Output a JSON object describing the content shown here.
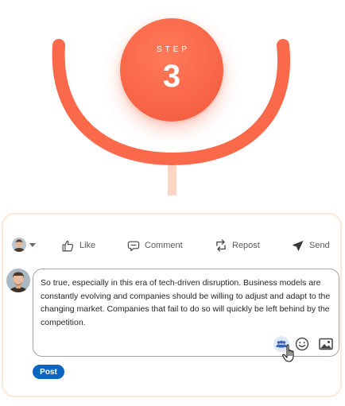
{
  "step": {
    "label": "STEP",
    "number": "3"
  },
  "colors": {
    "accent": "#f86849",
    "arc": "#f9694a",
    "connector": "#fcd5c4",
    "card_border": "#fde7d7",
    "post_button": "#0a66c2",
    "mention_icon": "#3564b3"
  },
  "action_bar": {
    "avatar_icon": "user-avatar",
    "items": [
      {
        "label": "Like",
        "icon": "thumbs-up-icon"
      },
      {
        "label": "Comment",
        "icon": "comment-bubble-icon"
      },
      {
        "label": "Repost",
        "icon": "repost-arrows-icon"
      },
      {
        "label": "Send",
        "icon": "paper-plane-icon"
      }
    ]
  },
  "comment": {
    "text": "So true, especially in this era of tech-driven disruption. Business models are constantly evolving and companies should be willing to adjust and adapt to the changing market. Companies that fail to do so will quickly be left behind by the competition.",
    "tools": [
      {
        "name": "mention",
        "icon": "people-mention-icon"
      },
      {
        "name": "emoji",
        "icon": "smiley-icon"
      },
      {
        "name": "image",
        "icon": "image-icon"
      }
    ]
  },
  "post": {
    "label": "Post"
  }
}
